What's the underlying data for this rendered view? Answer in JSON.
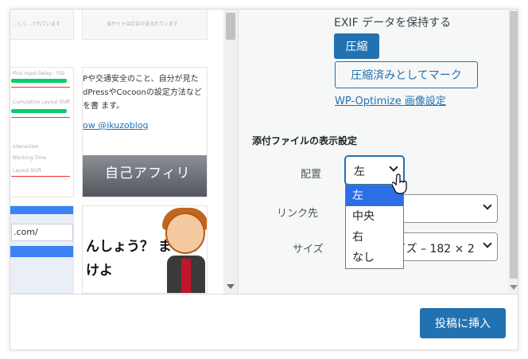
{
  "thumbnails": {
    "t1_caption": "…しく…でれています",
    "t2_caption": "当サイトは広告が含まれています",
    "t3_lines": [
      "First Input Delay - FID",
      "Cumulative Layout Shift",
      "Interaction",
      "Blocking Time",
      "Layout Shift"
    ],
    "t4_paragraph": "Pや交通安全のこと、自分が見た dPressやCocoonの設定方法などを書 ます。",
    "t4_link": "ow @ikuzoblog",
    "t4_banner": "自己アフィリ",
    "t5_url": ".com/",
    "t6_text": "んしょう？ まっとけよ"
  },
  "sidebar": {
    "exif_label": "EXIF データを保持する",
    "compress_button": "圧縮",
    "mark_compressed_button": "圧縮済みとしてマーク",
    "settings_link": "WP-Optimize 画像設定",
    "section_title": "添付ファイルの表示設定",
    "align_label": "配置",
    "align_value": "左",
    "link_label": "リンク先",
    "size_label": "サイズ",
    "size_value": "イズ – 182 × 2",
    "align_options": [
      "左",
      "中央",
      "右",
      "なし"
    ],
    "align_selected_index": 0
  },
  "footer": {
    "insert_button": "投稿に挿入"
  },
  "colors": {
    "accent": "#2271b1",
    "dropdown_highlight": "#2d6ee6"
  }
}
